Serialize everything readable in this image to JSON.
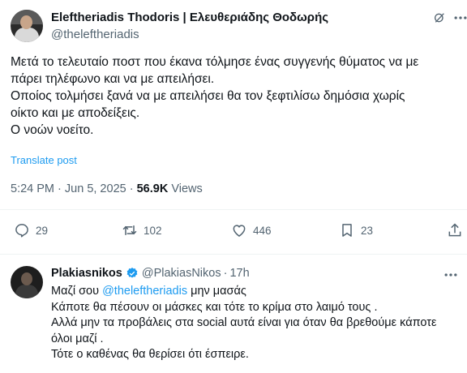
{
  "tweet": {
    "author_name": "Eleftheriadis Thodoris | Ελευθεριάδης Θοδωρής",
    "author_handle": "@theleftheriadis",
    "text_lines": [
      "Μετά το τελευταίο ποστ που έκανα τόλμησε ένας συγγενής θύματος να με",
      "πάρει τηλέφωνο και να με απειλήσει.",
      "Οποίος τολμήσει ξανά να με απειλήσει θα τον ξεφτιλίσω δημόσια χωρίς",
      "οίκτο και με αποδείξεις.",
      "Ο νοών νοείτο."
    ],
    "translate_label": "Translate post",
    "time": "5:24 PM",
    "date": "Jun 5, 2025",
    "separator": "·",
    "views_count": "56.9K",
    "views_label": "Views",
    "actions": {
      "replies": "29",
      "reposts": "102",
      "likes": "446",
      "bookmarks": "23"
    }
  },
  "reply": {
    "author_name": "Plakiasnikos",
    "author_handle": "@PlakiasNikos",
    "separator": "·",
    "time": "17h",
    "line1_prefix": "Μαζί σου ",
    "line1_mention": "@theleftheriadis",
    "line1_suffix": " μην μασάς",
    "lines": [
      "Κάποτε θα πέσουν οι μάσκες και τότε το κρίμα στο λαιμό τους .",
      "Αλλά μην τα προβάλεις στα social αυτά είναι για όταν θα βρεθούμε κάποτε",
      "όλοι μαζί .",
      "Τότε ο καθένας θα θερίσει ότι έσπειρε."
    ]
  },
  "colors": {
    "text": "#0f1419",
    "secondary": "#536471",
    "link": "#1d9bf0",
    "divider": "#eff3f4"
  },
  "icons": [
    "grok-icon",
    "more-icon",
    "reply-icon",
    "repost-icon",
    "like-icon",
    "bookmark-icon",
    "share-icon",
    "verified-badge-icon"
  ]
}
